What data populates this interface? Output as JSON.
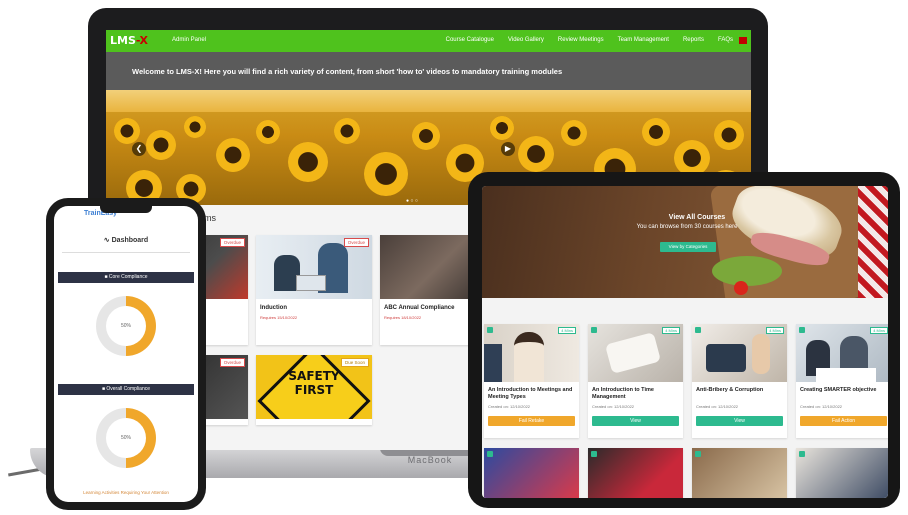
{
  "laptop": {
    "brand": "MacBook",
    "nav": {
      "logo": "LMS",
      "logo_accent": "-X",
      "admin_label": "Admin Panel",
      "links": [
        "Course Catalogue",
        "Video Gallery",
        "Review Meetings",
        "Team Management",
        "Reports",
        "FAQs"
      ]
    },
    "welcome_text": "Welcome to LMS-X! Here you will find a rich variety of content, from short 'how to' videos to mandatory training modules",
    "section_title": "ms",
    "cards": [
      {
        "title": "",
        "date": "",
        "badge": "Overdue"
      },
      {
        "title": "Induction",
        "date": "Requires 15/10/2022",
        "badge": "Overdue"
      },
      {
        "title": "ABC Annual Compliance",
        "date": "Requires 18/10/2022",
        "badge": "Overdue"
      },
      {
        "title": "",
        "date": "",
        "badge": "Overdue"
      },
      {
        "title": "",
        "date": "",
        "badge": "Due Soon",
        "image_text": [
          "SAFETY",
          "FIRST"
        ]
      }
    ]
  },
  "tablet": {
    "hero_title": "View All Courses",
    "hero_subtitle": "You can browse from 30 courses here",
    "hero_button": "View by Categories",
    "cards": [
      {
        "title": "An Introduction to Meetings and Meeting Types",
        "date": "Created on: 12/10/2022",
        "button": "Fail Retake",
        "color": "#f0a72b",
        "badge": "4 Mins"
      },
      {
        "title": "An Introduction to Time Management",
        "date": "Created on: 12/10/2022",
        "button": "View",
        "color": "#2dba8f",
        "badge": "4 Mins"
      },
      {
        "title": "Anti-Bribery & Corruption",
        "date": "Created on: 12/10/2022",
        "button": "View",
        "color": "#2dba8f",
        "badge": "4 Mins"
      },
      {
        "title": "Creating SMARTER objective",
        "date": "Created on: 12/10/2022",
        "button": "Fail Action",
        "color": "#f0a72b",
        "badge": "4 Mins"
      }
    ]
  },
  "phone": {
    "logo": "TrainEasy",
    "dashboard_title": "Dashboard",
    "sections": [
      {
        "label": "Core Compliance",
        "percent": "50%",
        "value": 0.5
      },
      {
        "label": "Overall Compliance",
        "percent": "50%",
        "value": 0.5
      }
    ],
    "footer": "Learning Activities Requiring Your Attention"
  },
  "colors": {
    "lms_green": "#4fc21d",
    "accent_orange": "#f0a72b",
    "accent_teal": "#2dba8f",
    "dark_bar": "#2d3245"
  }
}
